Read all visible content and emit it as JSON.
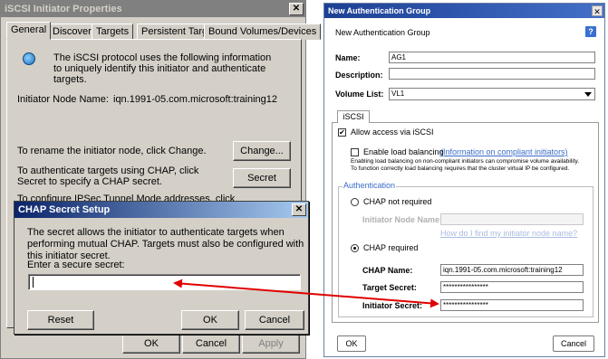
{
  "iscsi_window": {
    "title": "iSCSI Initiator Properties",
    "close_glyph": "✕",
    "tabs": [
      "General",
      "Discovery",
      "Targets",
      "Persistent Targets",
      "Bound Volumes/Devices"
    ],
    "intro_text": "The iSCSI protocol uses the following information to uniquely identify this initiator and authenticate targets.",
    "node_name_label": "Initiator Node Name:",
    "node_name_value": "iqn.1991-05.com.microsoft:training12",
    "rename_text": "To rename the initiator node, click Change.",
    "change_label": "Change...",
    "chap_text": "To authenticate targets using CHAP, click Secret to specify a CHAP secret.",
    "secret_label": "Secret",
    "ipsec_text": "To configure IPSec Tunnel Mode addresses, click",
    "ok_label": "OK",
    "cancel_label": "Cancel",
    "apply_label": "Apply",
    "icon": "network-globe-icon"
  },
  "chap_dialog": {
    "title": "CHAP Secret Setup",
    "close_glyph": "✕",
    "description": "The secret allows the initiator to authenticate targets when performing mutual CHAP.  Targets must also be configured with this initiator secret.",
    "secret_prompt": "Enter a secure secret:",
    "secret_value": "",
    "reset_label": "Reset",
    "ok_label": "OK",
    "cancel_label": "Cancel"
  },
  "auth_group": {
    "title": "New Authentication Group",
    "close_glyph": "✕",
    "heading": "New Authentication Group",
    "help_glyph": "?",
    "name_label": "Name:",
    "name_value": "AG1",
    "description_label": "Description:",
    "description_value": "",
    "volume_list_label": "Volume List:",
    "volume_list_value": "VL1",
    "tab_label": "iSCSI",
    "allow_access_label": "Allow access via iSCSI",
    "allow_access_checked": true,
    "load_balancing_label": "Enable load balancing",
    "load_balancing_link": "(Information on compliant initiators)",
    "load_balancing_note_1": "Enabling load balancing on non-compliant initiators can compromise volume availability.",
    "load_balancing_note_2": "To function correctly load balancing requires that the cluster virtual IP be configured.",
    "authentication_legend": "Authentication",
    "chap_not_required_label": "CHAP not required",
    "initiator_node_name_label": "Initiator Node Name:",
    "find_node_link": "How do I find my initiator node name?",
    "chap_required_label": "CHAP required",
    "chap_name_label": "CHAP Name:",
    "chap_name_value": "iqn.1991-05.com.microsoft:training12",
    "target_secret_label": "Target Secret:",
    "target_secret_value": "****************",
    "initiator_secret_label": "Initiator Secret:",
    "initiator_secret_value": "****************",
    "ok_label": "OK",
    "cancel_label": "Cancel"
  },
  "annotation": {
    "arrow_color": "#e00000"
  }
}
